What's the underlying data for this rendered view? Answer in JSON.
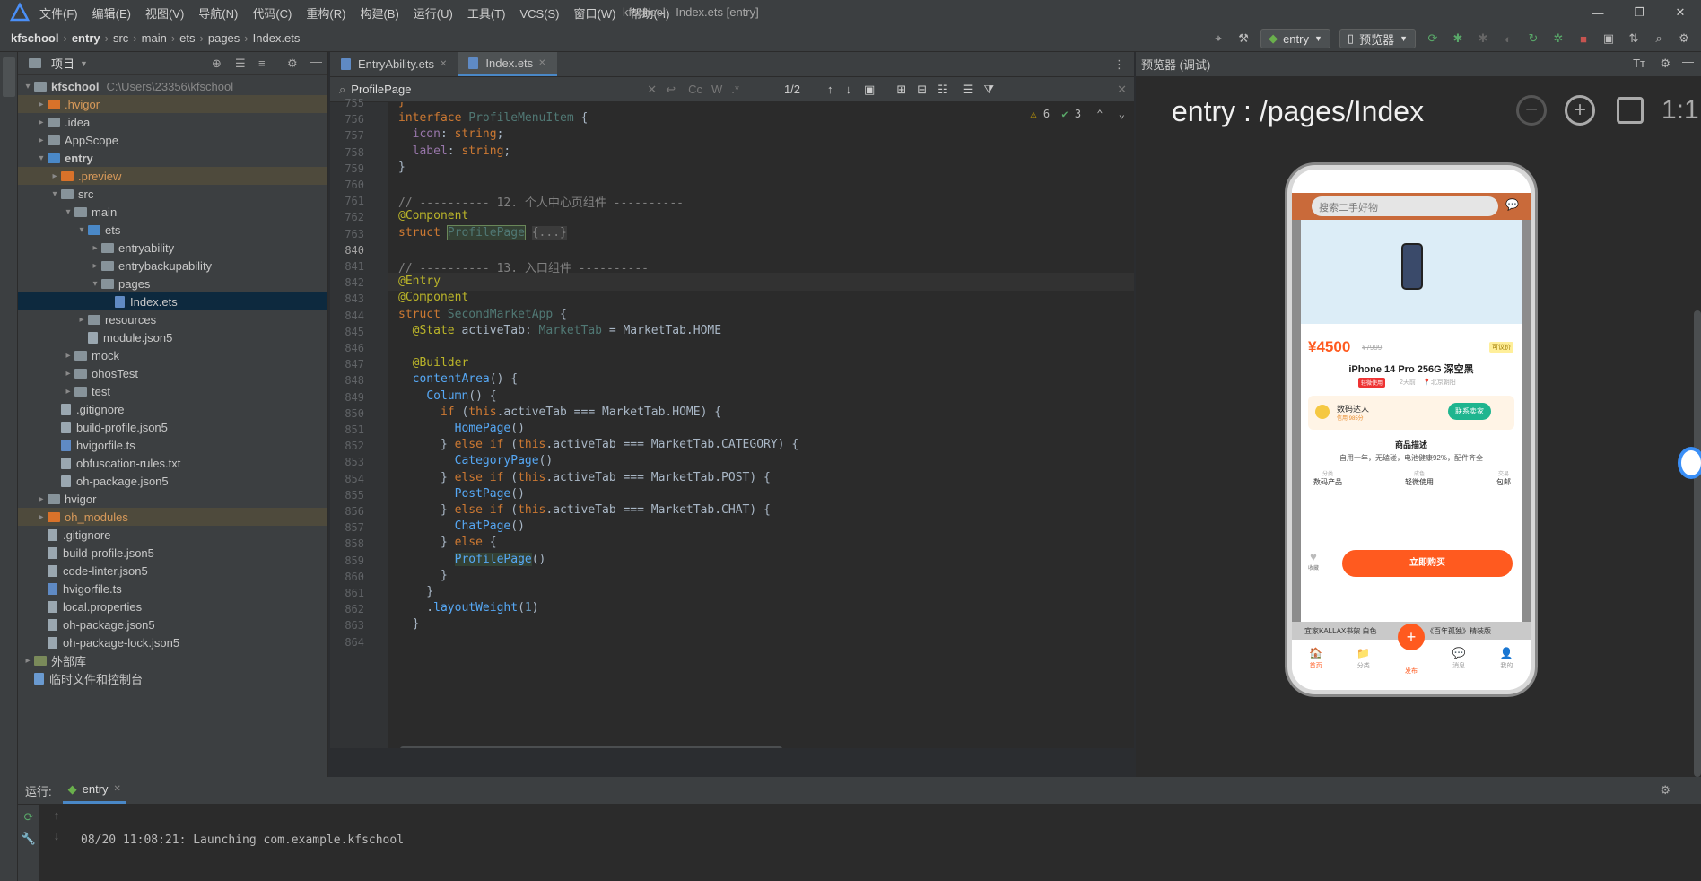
{
  "titlebar": {
    "menu": [
      "文件(F)",
      "编辑(E)",
      "视图(V)",
      "导航(N)",
      "代码(C)",
      "重构(R)",
      "构建(B)",
      "运行(U)",
      "工具(T)",
      "VCS(S)",
      "窗口(W)",
      "帮助(H)"
    ],
    "title": "kfschool - Index.ets [entry]"
  },
  "breadcrumb": [
    "kfschool",
    "entry",
    "src",
    "main",
    "ets",
    "pages",
    "Index.ets"
  ],
  "toolbar": {
    "module_combo": "entry",
    "preview_combo": "预览器"
  },
  "project_panel": {
    "title": "项目",
    "tree": [
      {
        "label": "kfschool",
        "extra": "C:\\Users\\23356\\kfschool",
        "indent": 0,
        "arrow": "▾",
        "kind": "folder",
        "bold": true
      },
      {
        "label": ".hvigor",
        "indent": 1,
        "arrow": "▸",
        "kind": "folder-orange",
        "hl": true
      },
      {
        "label": ".idea",
        "indent": 1,
        "arrow": "▸",
        "kind": "folder"
      },
      {
        "label": "AppScope",
        "indent": 1,
        "arrow": "▸",
        "kind": "folder"
      },
      {
        "label": "entry",
        "indent": 1,
        "arrow": "▾",
        "kind": "folder-blue",
        "bold": true
      },
      {
        "label": ".preview",
        "indent": 2,
        "arrow": "▸",
        "kind": "folder-orange",
        "hl": true
      },
      {
        "label": "src",
        "indent": 2,
        "arrow": "▾",
        "kind": "folder"
      },
      {
        "label": "main",
        "indent": 3,
        "arrow": "▾",
        "kind": "folder"
      },
      {
        "label": "ets",
        "indent": 4,
        "arrow": "▾",
        "kind": "folder-blue"
      },
      {
        "label": "entryability",
        "indent": 5,
        "arrow": "▸",
        "kind": "folder"
      },
      {
        "label": "entrybackupability",
        "indent": 5,
        "arrow": "▸",
        "kind": "folder"
      },
      {
        "label": "pages",
        "indent": 5,
        "arrow": "▾",
        "kind": "folder"
      },
      {
        "label": "Index.ets",
        "indent": 6,
        "arrow": "",
        "kind": "file-blue",
        "sel": true
      },
      {
        "label": "resources",
        "indent": 4,
        "arrow": "▸",
        "kind": "folder"
      },
      {
        "label": "module.json5",
        "indent": 4,
        "arrow": "",
        "kind": "file"
      },
      {
        "label": "mock",
        "indent": 3,
        "arrow": "▸",
        "kind": "folder"
      },
      {
        "label": "ohosTest",
        "indent": 3,
        "arrow": "▸",
        "kind": "folder"
      },
      {
        "label": "test",
        "indent": 3,
        "arrow": "▸",
        "kind": "folder"
      },
      {
        "label": ".gitignore",
        "indent": 2,
        "arrow": "",
        "kind": "file"
      },
      {
        "label": "build-profile.json5",
        "indent": 2,
        "arrow": "",
        "kind": "file"
      },
      {
        "label": "hvigorfile.ts",
        "indent": 2,
        "arrow": "",
        "kind": "file-blue"
      },
      {
        "label": "obfuscation-rules.txt",
        "indent": 2,
        "arrow": "",
        "kind": "file"
      },
      {
        "label": "oh-package.json5",
        "indent": 2,
        "arrow": "",
        "kind": "file"
      },
      {
        "label": "hvigor",
        "indent": 1,
        "arrow": "▸",
        "kind": "folder"
      },
      {
        "label": "oh_modules",
        "indent": 1,
        "arrow": "▸",
        "kind": "folder-orange",
        "hl": true
      },
      {
        "label": ".gitignore",
        "indent": 1,
        "arrow": "",
        "kind": "file"
      },
      {
        "label": "build-profile.json5",
        "indent": 1,
        "arrow": "",
        "kind": "file"
      },
      {
        "label": "code-linter.json5",
        "indent": 1,
        "arrow": "",
        "kind": "file"
      },
      {
        "label": "hvigorfile.ts",
        "indent": 1,
        "arrow": "",
        "kind": "file-blue"
      },
      {
        "label": "local.properties",
        "indent": 1,
        "arrow": "",
        "kind": "file"
      },
      {
        "label": "oh-package.json5",
        "indent": 1,
        "arrow": "",
        "kind": "file"
      },
      {
        "label": "oh-package-lock.json5",
        "indent": 1,
        "arrow": "",
        "kind": "file"
      },
      {
        "label": "外部库",
        "indent": 0,
        "arrow": "▸",
        "kind": "lib"
      },
      {
        "label": "临时文件和控制台",
        "indent": 0,
        "arrow": "",
        "kind": "scratch"
      }
    ]
  },
  "editor": {
    "tabs": [
      {
        "label": "EntryAbility.ets",
        "active": false
      },
      {
        "label": "Index.ets",
        "active": true
      }
    ],
    "find": {
      "query": "ProfilePage",
      "count": "1/2"
    },
    "warnings": "6",
    "ok": "3",
    "lines": [
      {
        "n": "755",
        "html": "<span class='orange'>}</span>"
      },
      {
        "n": "756",
        "html": "<span class='kw'>interface</span> <span class='ty'>ProfileMenuItem</span> {"
      },
      {
        "n": "757",
        "html": "  <span class='prop'>icon</span>: <span class='kw'>string</span>;"
      },
      {
        "n": "758",
        "html": "  <span class='prop'>label</span>: <span class='kw'>string</span>;"
      },
      {
        "n": "759",
        "html": "}"
      },
      {
        "n": "760",
        "html": ""
      },
      {
        "n": "761",
        "html": "<span class='cm'>// ---------- 12. 个人中心页组件 ----------</span>"
      },
      {
        "n": "762",
        "html": "<span class='ann'>@Component</span>"
      },
      {
        "n": "763",
        "html": "<span class='kw'>struct</span> <span class='ty' style='background:#344134;outline:1px solid #6a8759'>ProfilePage</span> <span class='cm' style='background:#3b3b3b'>{...}</span>"
      },
      {
        "n": "840",
        "html": ""
      },
      {
        "n": "841",
        "html": "<span class='cm'>// ---------- 13. 入口组件 ----------</span>"
      },
      {
        "n": "842",
        "html": "<span class='ann'>@Entry</span>"
      },
      {
        "n": "843",
        "html": "<span class='ann'>@Component</span>"
      },
      {
        "n": "844",
        "html": "<span class='kw'>struct</span> <span class='ty'>SecondMarketApp</span> {"
      },
      {
        "n": "845",
        "html": "  <span class='ann'>@State</span> activeTab: <span class='ty'>MarketTab</span> = MarketTab.HOME"
      },
      {
        "n": "846",
        "html": ""
      },
      {
        "n": "847",
        "html": "  <span class='ann'>@Builder</span>"
      },
      {
        "n": "848",
        "html": "  <span class='fn'>contentArea</span>() {"
      },
      {
        "n": "849",
        "html": "    <span class='fn'>Column</span>() {"
      },
      {
        "n": "850",
        "html": "      <span class='kw'>if</span> (<span class='kw'>this</span>.activeTab === MarketTab.HOME) {"
      },
      {
        "n": "851",
        "html": "        <span class='fn'>HomePage</span>()"
      },
      {
        "n": "852",
        "html": "      } <span class='kw'>else if</span> (<span class='kw'>this</span>.activeTab === MarketTab.CATEGORY) {"
      },
      {
        "n": "853",
        "html": "        <span class='fn'>CategoryPage</span>()"
      },
      {
        "n": "854",
        "html": "      } <span class='kw'>else if</span> (<span class='kw'>this</span>.activeTab === MarketTab.POST) {"
      },
      {
        "n": "855",
        "html": "        <span class='fn'>PostPage</span>()"
      },
      {
        "n": "856",
        "html": "      } <span class='kw'>else if</span> (<span class='kw'>this</span>.activeTab === MarketTab.CHAT) {"
      },
      {
        "n": "857",
        "html": "        <span class='fn'>ChatPage</span>()"
      },
      {
        "n": "858",
        "html": "      } <span class='kw'>else</span> {"
      },
      {
        "n": "859",
        "html": "        <span class='fn' style='background:#344134'>ProfilePage</span>()"
      },
      {
        "n": "860",
        "html": "      }"
      },
      {
        "n": "861",
        "html": "    }"
      },
      {
        "n": "862",
        "html": "    .<span class='fn'>layoutWeight</span>(<span class='num'>1</span>)"
      },
      {
        "n": "863",
        "html": "  }"
      },
      {
        "n": "864",
        "html": ""
      }
    ]
  },
  "preview": {
    "panel_title": "预览器 (调试)",
    "route": "entry : /pages/Index",
    "zoom_reset": "1:1",
    "phone": {
      "search_placeholder": "搜索二手好物",
      "price": "¥4500",
      "orig_price": "¥7999",
      "tag": "可议价",
      "product_title": "iPhone 14 Pro 256G 深空黑",
      "badge": "轻微使用",
      "time": "2天前",
      "location": "北京朝阳",
      "seller_name": "数码达人",
      "seller_sub": "信用 985分",
      "contact_btn": "联系卖家",
      "desc_title": "商品描述",
      "desc_text": "自用一年，无磕碰，电池健康92%，配件齐全",
      "attrs": [
        {
          "k": "分类",
          "v": "数码产品"
        },
        {
          "k": "成色",
          "v": "轻微使用"
        },
        {
          "k": "交易",
          "v": "包邮"
        }
      ],
      "fav_label": "收藏",
      "buy_btn": "立即购买",
      "below_left": "宜家KALLAX书架 白色",
      "below_right": "《百年孤独》精装版",
      "tabs": [
        "首页",
        "分类",
        "发布",
        "消息",
        "我的"
      ]
    }
  },
  "run": {
    "label": "运行:",
    "tab": "entry",
    "log": "08/20 11:08:21: Launching com.example.kfschool"
  }
}
